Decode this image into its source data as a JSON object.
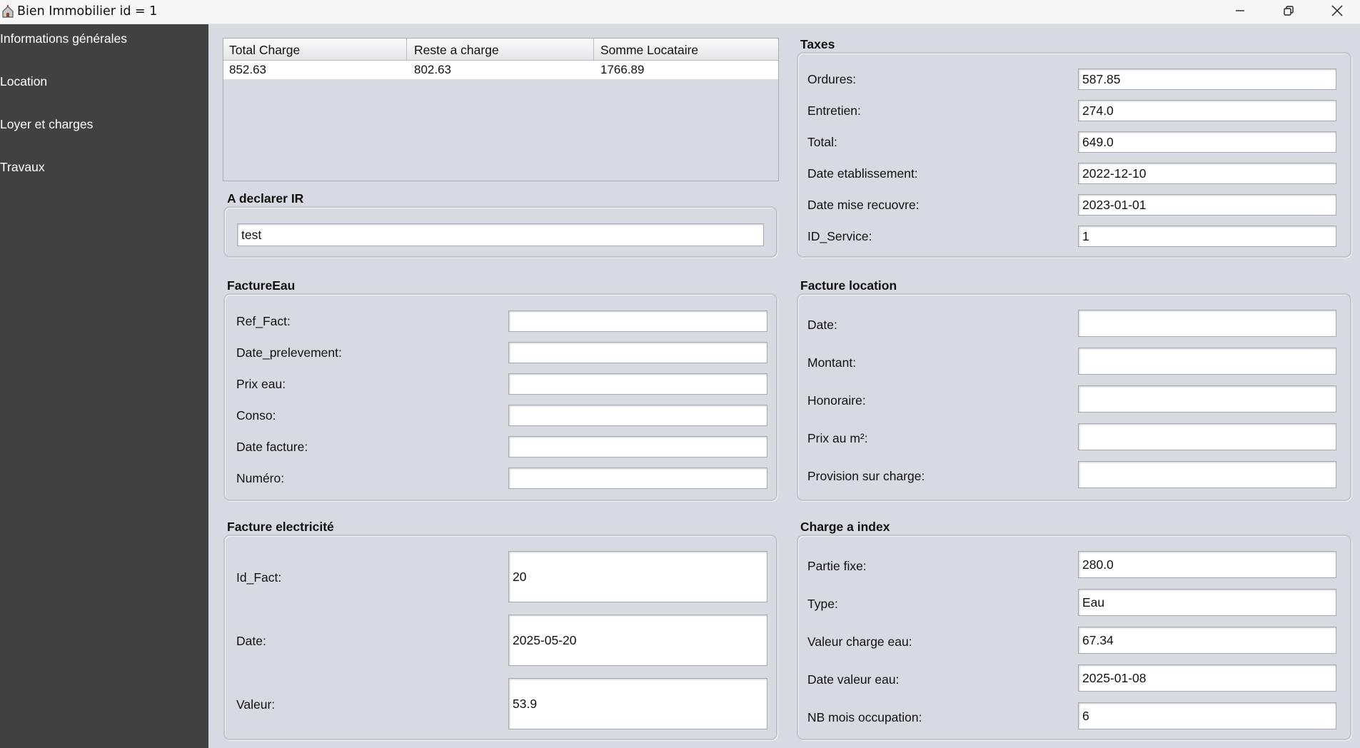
{
  "window": {
    "title": "Bien Immobilier id = 1"
  },
  "sidebar": {
    "items": [
      {
        "label": "Informations générales"
      },
      {
        "label": "Location"
      },
      {
        "label": "Loyer et charges"
      },
      {
        "label": "Travaux"
      }
    ]
  },
  "summary": {
    "columns": [
      "Total Charge",
      "Reste a charge",
      "Somme Locataire"
    ],
    "rows": [
      [
        "852.63",
        "802.63",
        "1766.89"
      ]
    ]
  },
  "declarer_ir": {
    "title": "A declarer IR",
    "value": "test"
  },
  "taxes": {
    "title": "Taxes",
    "fields": [
      {
        "label": "Ordures:",
        "value": "587.85"
      },
      {
        "label": "Entretien:",
        "value": "274.0"
      },
      {
        "label": "Total:",
        "value": "649.0"
      },
      {
        "label": "Date etablissement:",
        "value": "2022-12-10"
      },
      {
        "label": "Date mise recuovre:",
        "value": "2023-01-01"
      },
      {
        "label": "ID_Service:",
        "value": "1"
      }
    ]
  },
  "facture_eau": {
    "title": "FactureEau",
    "fields": [
      {
        "label": "Ref_Fact:",
        "value": ""
      },
      {
        "label": "Date_prelevement:",
        "value": ""
      },
      {
        "label": "Prix eau:",
        "value": ""
      },
      {
        "label": "Conso:",
        "value": ""
      },
      {
        "label": "Date facture:",
        "value": ""
      },
      {
        "label": "Numéro:",
        "value": ""
      }
    ]
  },
  "facture_location": {
    "title": "Facture location",
    "fields": [
      {
        "label": "Date:",
        "value": ""
      },
      {
        "label": "Montant:",
        "value": ""
      },
      {
        "label": "Honoraire:",
        "value": ""
      },
      {
        "label": "Prix au m²:",
        "value": ""
      },
      {
        "label": "Provision sur charge:",
        "value": ""
      }
    ]
  },
  "facture_electricite": {
    "title": "Facture electricité",
    "fields": [
      {
        "label": "Id_Fact:",
        "value": "20"
      },
      {
        "label": "Date:",
        "value": "2025-05-20"
      },
      {
        "label": "Valeur:",
        "value": "53.9"
      }
    ]
  },
  "charge_index": {
    "title": "Charge a index",
    "fields": [
      {
        "label": "Partie fixe:",
        "value": "280.0"
      },
      {
        "label": "Type:",
        "value": "Eau"
      },
      {
        "label": "Valeur charge eau:",
        "value": "67.34"
      },
      {
        "label": "Date valeur eau:",
        "value": "2025-01-08"
      },
      {
        "label": "NB mois occupation:",
        "value": "6"
      }
    ]
  },
  "icons": {
    "app": "house-key-icon",
    "minimize": "minimize-icon",
    "maximize": "restore-icon",
    "close": "close-icon"
  },
  "colors": {
    "sidebar_bg": "#414141",
    "main_bg": "#d7dae1",
    "titlebar_bg": "#f7f7f8"
  }
}
